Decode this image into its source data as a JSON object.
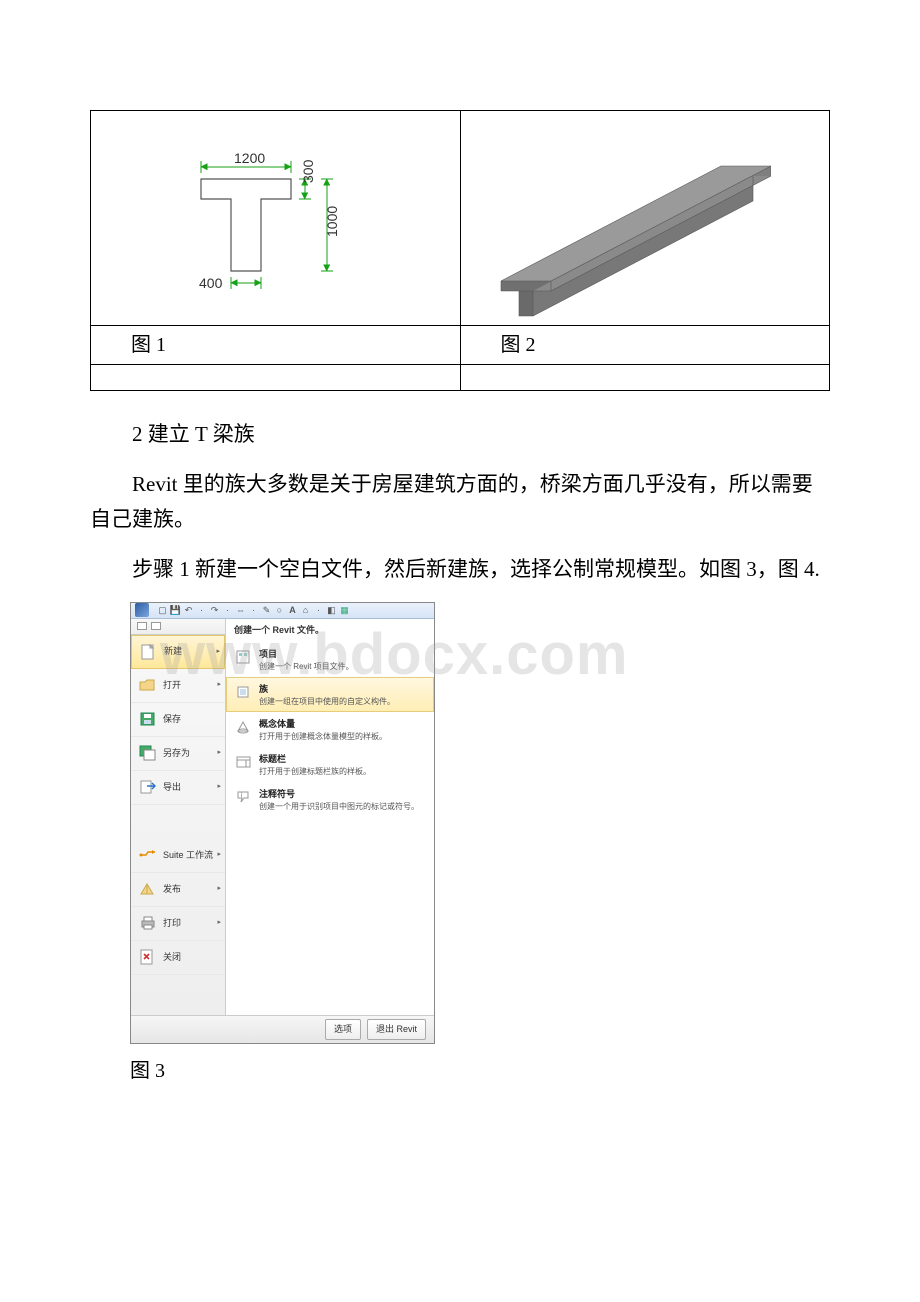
{
  "fig_labels": {
    "fig1": "图 1",
    "fig2": "图 2",
    "fig3": "图 3"
  },
  "dimensions": {
    "top_width": "1200",
    "flange_height": "300",
    "web_height": "1000",
    "web_width": "400"
  },
  "section2_heading": "2 建立 T 梁族",
  "paragraph1": "Revit 里的族大多数是关于房屋建筑方面的，桥梁方面几乎没有，所以需要自己建族。",
  "paragraph2": "步骤 1 新建一个空白文件，然后新建族，选择公制常规模型。如图 3，图 4.",
  "revit_menu": {
    "header": "创建一个 Revit 文件。",
    "left_items": [
      {
        "label": "新建",
        "icon": "new",
        "arrow": true,
        "selected": true
      },
      {
        "label": "打开",
        "icon": "open",
        "arrow": true
      },
      {
        "label": "保存",
        "icon": "save"
      },
      {
        "label": "另存为",
        "icon": "saveas",
        "arrow": true
      },
      {
        "label": "导出",
        "icon": "export",
        "arrow": true
      },
      {
        "label": "Suite 工作流",
        "icon": "suite",
        "arrow": true,
        "gap_before": true
      },
      {
        "label": "发布",
        "icon": "publish",
        "arrow": true
      },
      {
        "label": "打印",
        "icon": "print",
        "arrow": true
      },
      {
        "label": "关闭",
        "icon": "close"
      }
    ],
    "right_items": [
      {
        "title": "项目",
        "desc": "创建一个 Revit 项目文件。"
      },
      {
        "title": "族",
        "desc": "创建一组在项目中使用的自定义构件。",
        "selected": true
      },
      {
        "title": "概念体量",
        "desc": "打开用于创建概念体量模型的样板。"
      },
      {
        "title": "标题栏",
        "desc": "打开用于创建标题栏族的样板。"
      },
      {
        "title": "注释符号",
        "desc": "创建一个用于识别项目中图元的标记或符号。"
      }
    ],
    "footer_buttons": {
      "options": "选项",
      "exit": "退出 Revit"
    }
  },
  "watermark": "www.bdocx.com"
}
